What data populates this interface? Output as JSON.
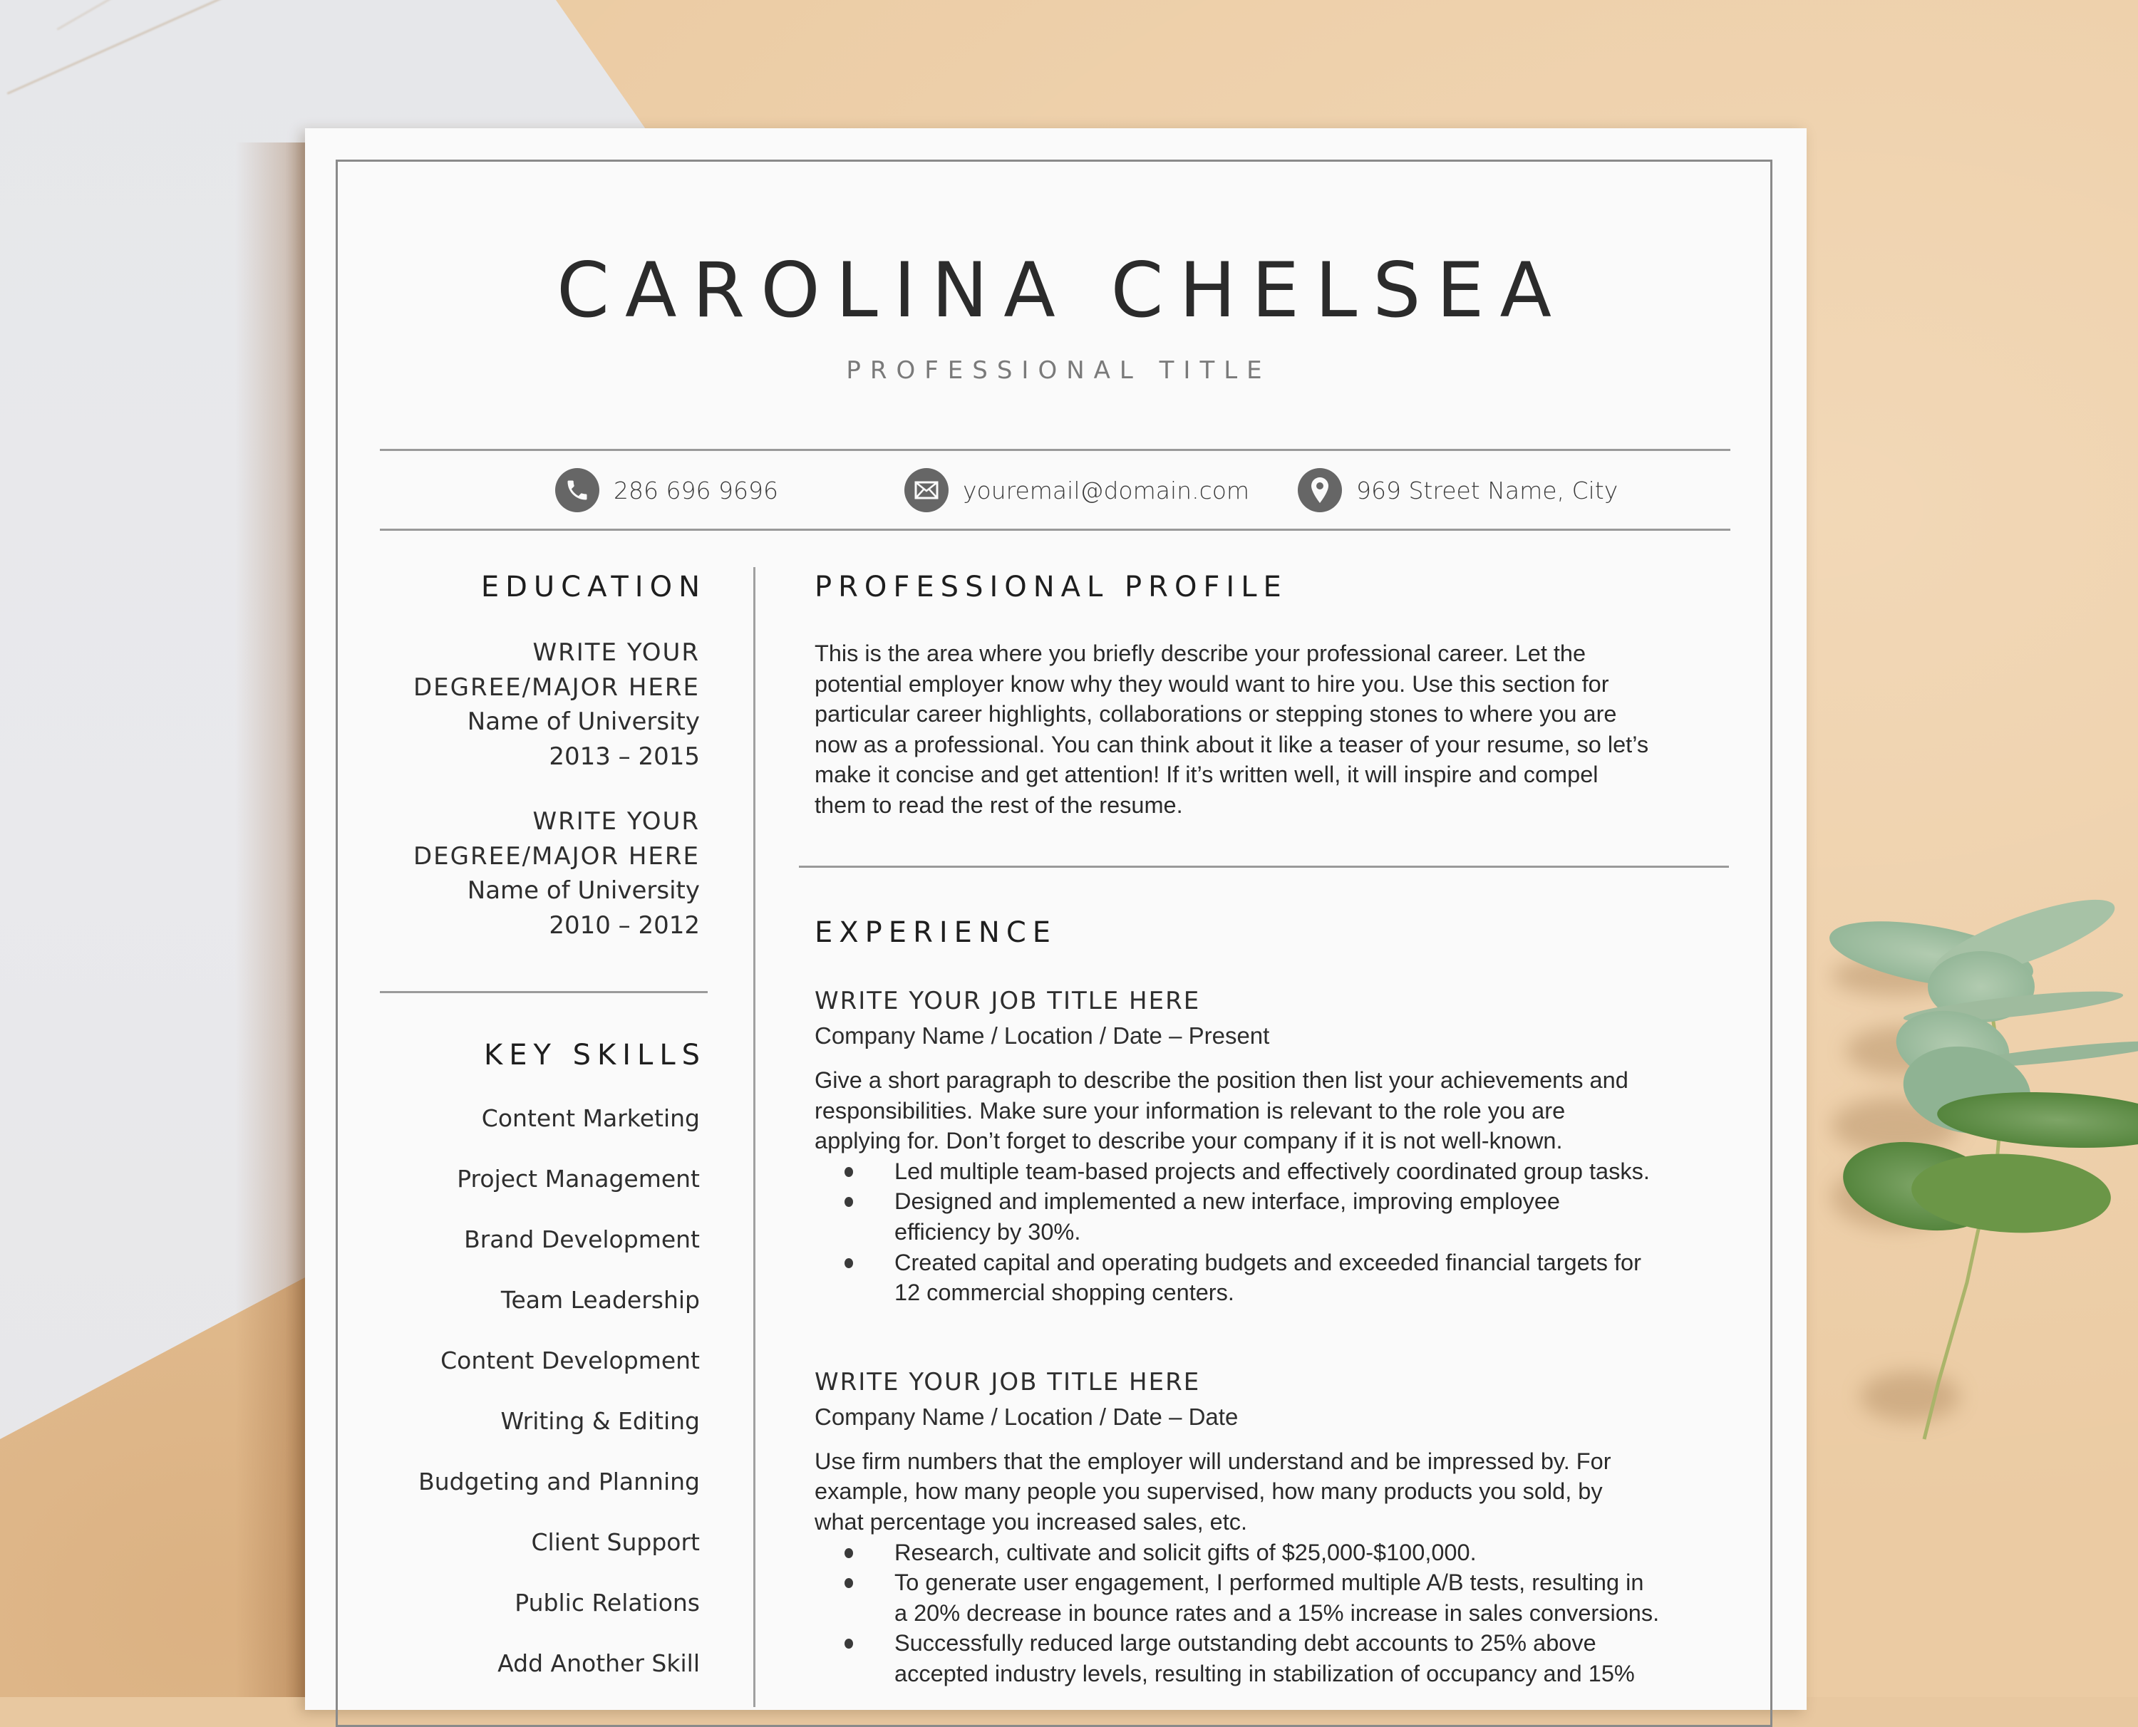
{
  "resume": {
    "name": "CAROLINA CHELSEA",
    "professional_title": "PROFESSIONAL TITLE",
    "contact": {
      "phone": {
        "icon": "phone-icon",
        "text": "286 696 9696"
      },
      "email": {
        "icon": "envelope-icon",
        "text": "youremail@domain.com"
      },
      "address": {
        "icon": "map-pin-icon",
        "text": "969 Street Name, City"
      }
    },
    "education": {
      "heading": "EDUCATION",
      "entries": [
        {
          "degree_line1": "WRITE YOUR",
          "degree_line2": "DEGREE/MAJOR HERE",
          "university": "Name of University",
          "years": "2013 – 2015"
        },
        {
          "degree_line1": "WRITE YOUR",
          "degree_line2": "DEGREE/MAJOR HERE",
          "university": "Name of University",
          "years": "2010 – 2012"
        }
      ]
    },
    "skills": {
      "heading": "KEY SKILLS",
      "items": [
        "Content Marketing",
        "Project Management",
        "Brand Development",
        "Team Leadership",
        "Content Development",
        "Writing & Editing",
        "Budgeting and Planning",
        "Client Support",
        "Public Relations",
        "Add Another Skill"
      ]
    },
    "profile": {
      "heading": "PROFESSIONAL PROFILE",
      "lines": [
        "This is the area where you briefly describe your professional career. Let the",
        "potential employer know why they would want to hire you. Use this section for",
        "particular career highlights, collaborations or stepping stones to where you are",
        "now as a professional. You can think about it like a teaser of your resume, so let’s",
        "make it concise and get attention! If it’s written well, it will inspire and compel",
        "them to read the rest of the resume."
      ]
    },
    "experience": {
      "heading": "EXPERIENCE",
      "jobs": [
        {
          "title": "WRITE YOUR JOB TITLE HERE",
          "meta": "Company Name / Location / Date – Present",
          "description_lines": [
            "Give a short paragraph to describe the position then list your achievements and",
            "responsibilities. Make sure your information is relevant to the role you are",
            "applying for. Don’t forget to describe your company if it is not well-known."
          ],
          "bullets": [
            [
              "Led multiple team-based projects and effectively coordinated group tasks."
            ],
            [
              "Designed and implemented a new interface, improving employee",
              "efficiency by 30%."
            ],
            [
              "Created capital and operating budgets and exceeded financial targets for",
              "12 commercial shopping centers."
            ]
          ]
        },
        {
          "title": "WRITE YOUR JOB TITLE HERE",
          "meta": "Company Name / Location / Date – Date",
          "description_lines": [
            "Use firm numbers that the employer will understand and be impressed by. For",
            "example, how many people you supervised, how many products you sold, by",
            "what percentage you increased sales, etc."
          ],
          "bullets": [
            [
              "Research, cultivate and solicit gifts of $25,000-$100,000."
            ],
            [
              "To generate user engagement, I performed multiple A/B tests, resulting in",
              "a 20% decrease in bounce rates and a 15% increase in sales conversions."
            ],
            [
              "Successfully reduced large outstanding debt accounts to 25% above",
              "accepted industry levels, resulting in stabilization of occupancy and 15%"
            ]
          ]
        }
      ]
    }
  },
  "scene": {
    "background": "kraft-paper",
    "left_prop": "marble-slab",
    "right_prop": "eucalyptus-sprig",
    "colors": {
      "kraft": "#ebcba3",
      "marble": "#e7e8eb",
      "paper": "#fafafa",
      "rule": "#9a9a9a",
      "icon": "#666666",
      "ink": "#2b2b2b",
      "subtitle": "#7a7a7a",
      "leaf_light": "#9dbb9e",
      "leaf_dark": "#5f8e4a"
    }
  }
}
